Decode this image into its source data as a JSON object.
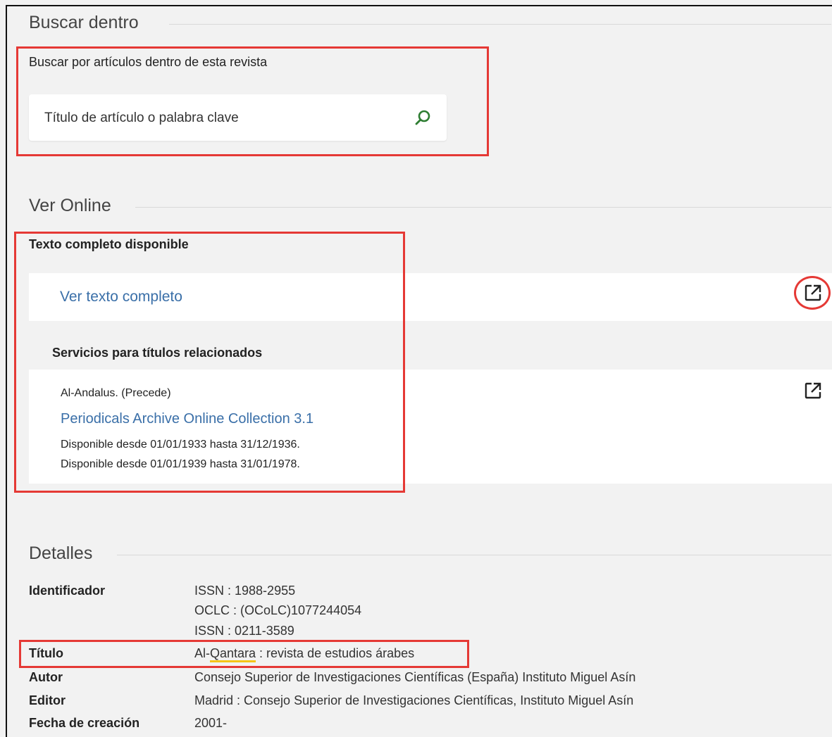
{
  "search_within": {
    "title": "Buscar dentro",
    "hint": "Buscar por artículos dentro de esta revista",
    "placeholder": "Título de artículo o palabra clave"
  },
  "view_online": {
    "title": "Ver Online",
    "fulltext_heading": "Texto completo disponible",
    "fulltext_link": "Ver texto completo",
    "related_heading": "Servicios para títulos relacionados",
    "related": {
      "relation": "Al-Andalus. (Precede)",
      "collection_link": "Periodicals Archive Online Collection 3.1",
      "availability": [
        "Disponible desde 01/01/1933 hasta 31/12/1936.",
        "Disponible desde 01/01/1939 hasta 31/01/1978."
      ]
    }
  },
  "details": {
    "title": "Detalles",
    "identifier_label": "Identificador",
    "identifiers": [
      "ISSN : 1988-2955",
      "OCLC : (OCoLC)1077244054",
      "ISSN : 0211-3589"
    ],
    "title_label": "Título",
    "title_value_prefix": "Al-",
    "title_value_highlight": "Qantara",
    "title_value_suffix": " : revista de estudios árabes",
    "author_label": "Autor",
    "author_value": "Consejo Superior de Investigaciones Científicas (España) Instituto Miguel Asín",
    "publisher_label": "Editor",
    "publisher_value": "Madrid : Consejo Superior de Investigaciones Científicas, Instituto Miguel Asín",
    "creation_date_label": "Fecha de creación",
    "creation_date_value": "2001-"
  },
  "icons": {
    "search": "search-icon",
    "external_link": "external-link-icon"
  },
  "colors": {
    "link": "#3a6fa8",
    "search_icon": "#2e7d32",
    "annotation": "#e53935",
    "highlight": "#f5c518"
  }
}
